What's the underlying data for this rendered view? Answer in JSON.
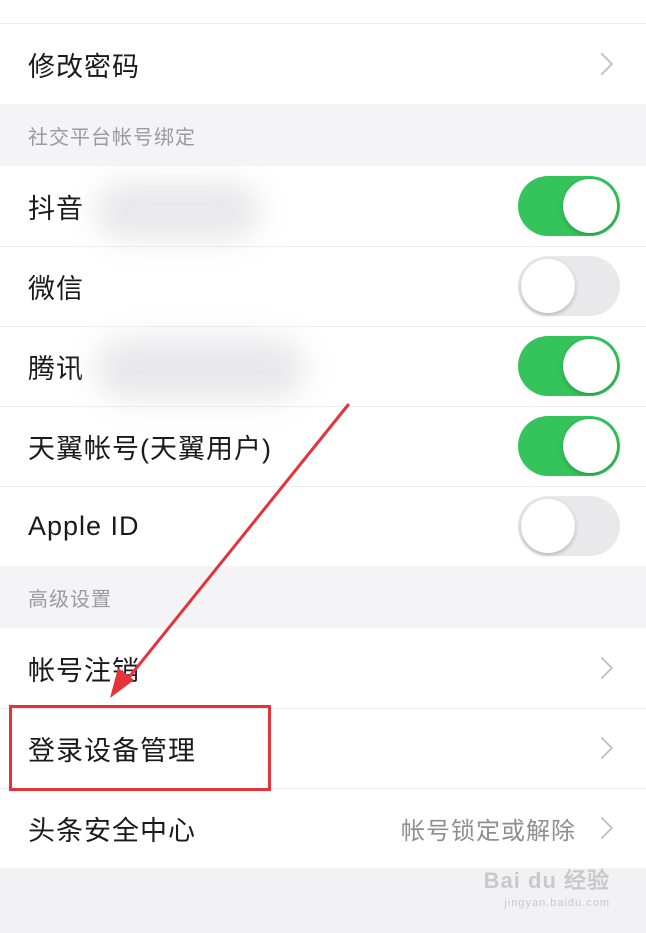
{
  "screen": {
    "top_group": {
      "change_password_label": "修改密码"
    },
    "social_section": {
      "header": "社交平台帐号绑定",
      "items": [
        {
          "label": "抖音",
          "toggle_on": true
        },
        {
          "label": "微信",
          "toggle_on": false
        },
        {
          "label": "腾讯",
          "toggle_on": true
        },
        {
          "label": "天翼帐号(天翼用户)",
          "toggle_on": true
        },
        {
          "label": "Apple ID",
          "toggle_on": false
        }
      ]
    },
    "advanced_section": {
      "header": "高级设置",
      "items": [
        {
          "label": "帐号注销"
        },
        {
          "label": "登录设备管理"
        },
        {
          "label": "头条安全中心",
          "value": "帐号锁定或解除"
        }
      ]
    }
  },
  "annotation": {
    "highlight_color": "#e5333b",
    "highlighted_item": "登录设备管理"
  },
  "watermark": {
    "main": "Bai du 经验",
    "sub": "jingyan.baidu.com"
  },
  "colors": {
    "toggle_on": "#35c35b",
    "toggle_off": "#e9e9eb",
    "background": "#f2f2f4"
  }
}
